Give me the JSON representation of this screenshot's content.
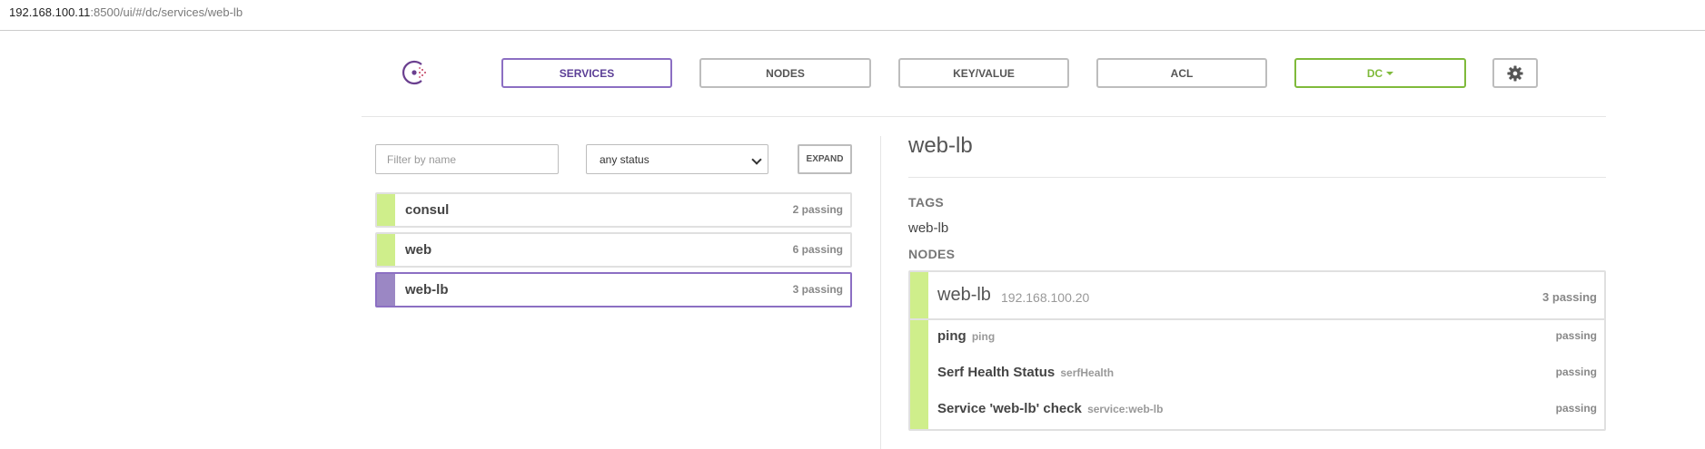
{
  "browser": {
    "host": "192.168.100.11",
    "rest": ":8500/ui/#/dc/services/web-lb"
  },
  "nav": {
    "logo_icon": "consul-logo-icon",
    "items": [
      {
        "label": "SERVICES"
      },
      {
        "label": "NODES"
      },
      {
        "label": "KEY/VALUE"
      },
      {
        "label": "ACL"
      }
    ],
    "dc_label": "DC",
    "settings_icon": "gear-icon"
  },
  "colors": {
    "passing": "#cfee8b",
    "selected": "#9b87c4",
    "accent": "#8c6fc3",
    "dc": "#7fba3b"
  },
  "filters": {
    "search_placeholder": "Filter by name",
    "status_value": "any status",
    "expand_label": "EXPAND"
  },
  "services": [
    {
      "name": "consul",
      "count": "2 passing"
    },
    {
      "name": "web",
      "count": "6 passing"
    },
    {
      "name": "web-lb",
      "count": "3 passing"
    }
  ],
  "detail": {
    "title": "web-lb",
    "tags_label": "TAGS",
    "tag": "web-lb",
    "nodes_label": "NODES",
    "node": {
      "name": "web-lb",
      "address": "192.168.100.20",
      "count": "3 passing",
      "checks": [
        {
          "name": "ping",
          "id": "ping",
          "status": "passing"
        },
        {
          "name": "Serf Health Status",
          "id": "serfHealth",
          "status": "passing"
        },
        {
          "name": "Service 'web-lb' check",
          "id": "service:web-lb",
          "status": "passing"
        }
      ]
    }
  }
}
